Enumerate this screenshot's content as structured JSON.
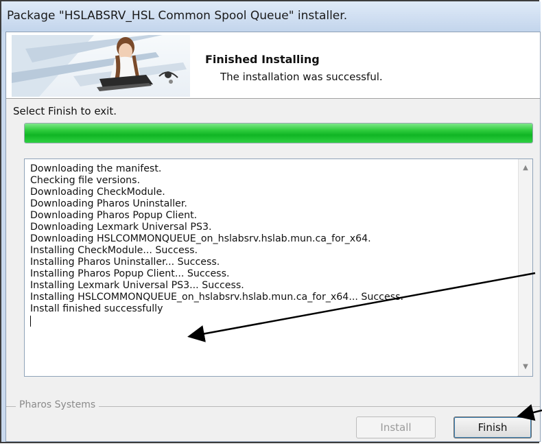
{
  "window": {
    "title": "Package \"HSLABSRV_HSL Common Spool Queue\" installer."
  },
  "header": {
    "title": "Finished Installing",
    "subtitle": "The installation was successful.",
    "banner_icon": "woman-at-laptop-banner"
  },
  "instruction": "Select Finish to exit.",
  "progress": {
    "value_percent": 100,
    "color": "#1fc12f"
  },
  "log": {
    "lines": [
      "Downloading the manifest.",
      "Checking file versions.",
      "Downloading CheckModule.",
      "Downloading Pharos Uninstaller.",
      "Downloading Pharos Popup Client.",
      "Downloading Lexmark Universal PS3.",
      "Downloading HSLCOMMONQUEUE_on_hslabsrv.hslab.mun.ca_for_x64.",
      "Installing CheckModule... Success.",
      "Installing Pharos Uninstaller... Success.",
      "Installing Pharos Popup Client... Success.",
      "Installing Lexmark Universal PS3... Success.",
      "Installing HSLCOMMONQUEUE_on_hslabsrv.hslab.mun.ca_for_x64... Success.",
      "Install finished successfully"
    ]
  },
  "footer": {
    "group_label": "Pharos Systems",
    "install_label": "Install",
    "finish_label": "Finish"
  },
  "annotations": {
    "arrow_color": "#000000"
  }
}
